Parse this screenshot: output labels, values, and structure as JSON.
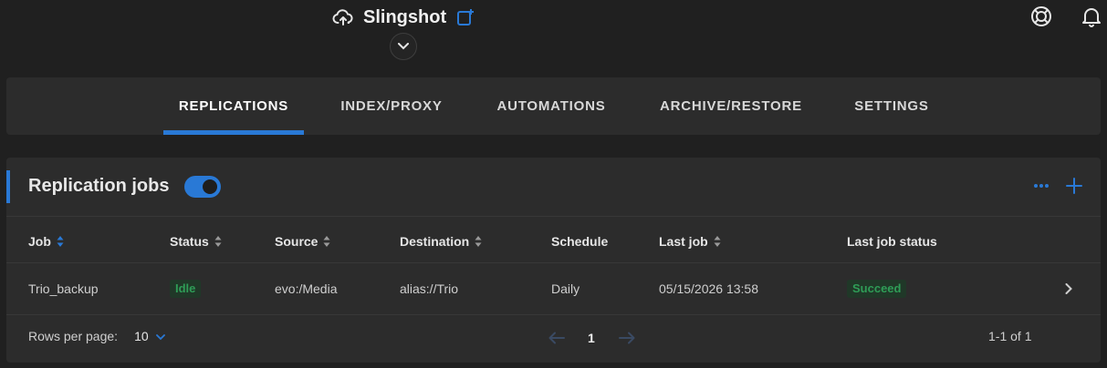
{
  "app": {
    "title": "Slingshot"
  },
  "tabs": [
    {
      "label": "REPLICATIONS",
      "active": true
    },
    {
      "label": "INDEX/PROXY",
      "active": false
    },
    {
      "label": "AUTOMATIONS",
      "active": false
    },
    {
      "label": "ARCHIVE/RESTORE",
      "active": false
    },
    {
      "label": "SETTINGS",
      "active": false
    }
  ],
  "panel": {
    "title": "Replication jobs",
    "toggle_on": true
  },
  "table": {
    "headers": [
      "Job",
      "Status",
      "Source",
      "Destination",
      "Schedule",
      "Last job",
      "Last job status"
    ],
    "rows": [
      {
        "job": "Trio_backup",
        "status": "Idle",
        "source": "evo:/Media",
        "destination": "alias://Trio",
        "schedule": "Daily",
        "last_job": "05/15/2026 13:58",
        "last_job_status": "Succeed"
      }
    ]
  },
  "pagination": {
    "rows_per_page_label": "Rows per page:",
    "rows_per_page_value": "10",
    "current_page": "1",
    "range_text": "1-1 of 1"
  },
  "colors": {
    "accent": "#2979d6",
    "success": "#2f9d57",
    "panel": "#2c2c2c",
    "background": "#202020"
  }
}
